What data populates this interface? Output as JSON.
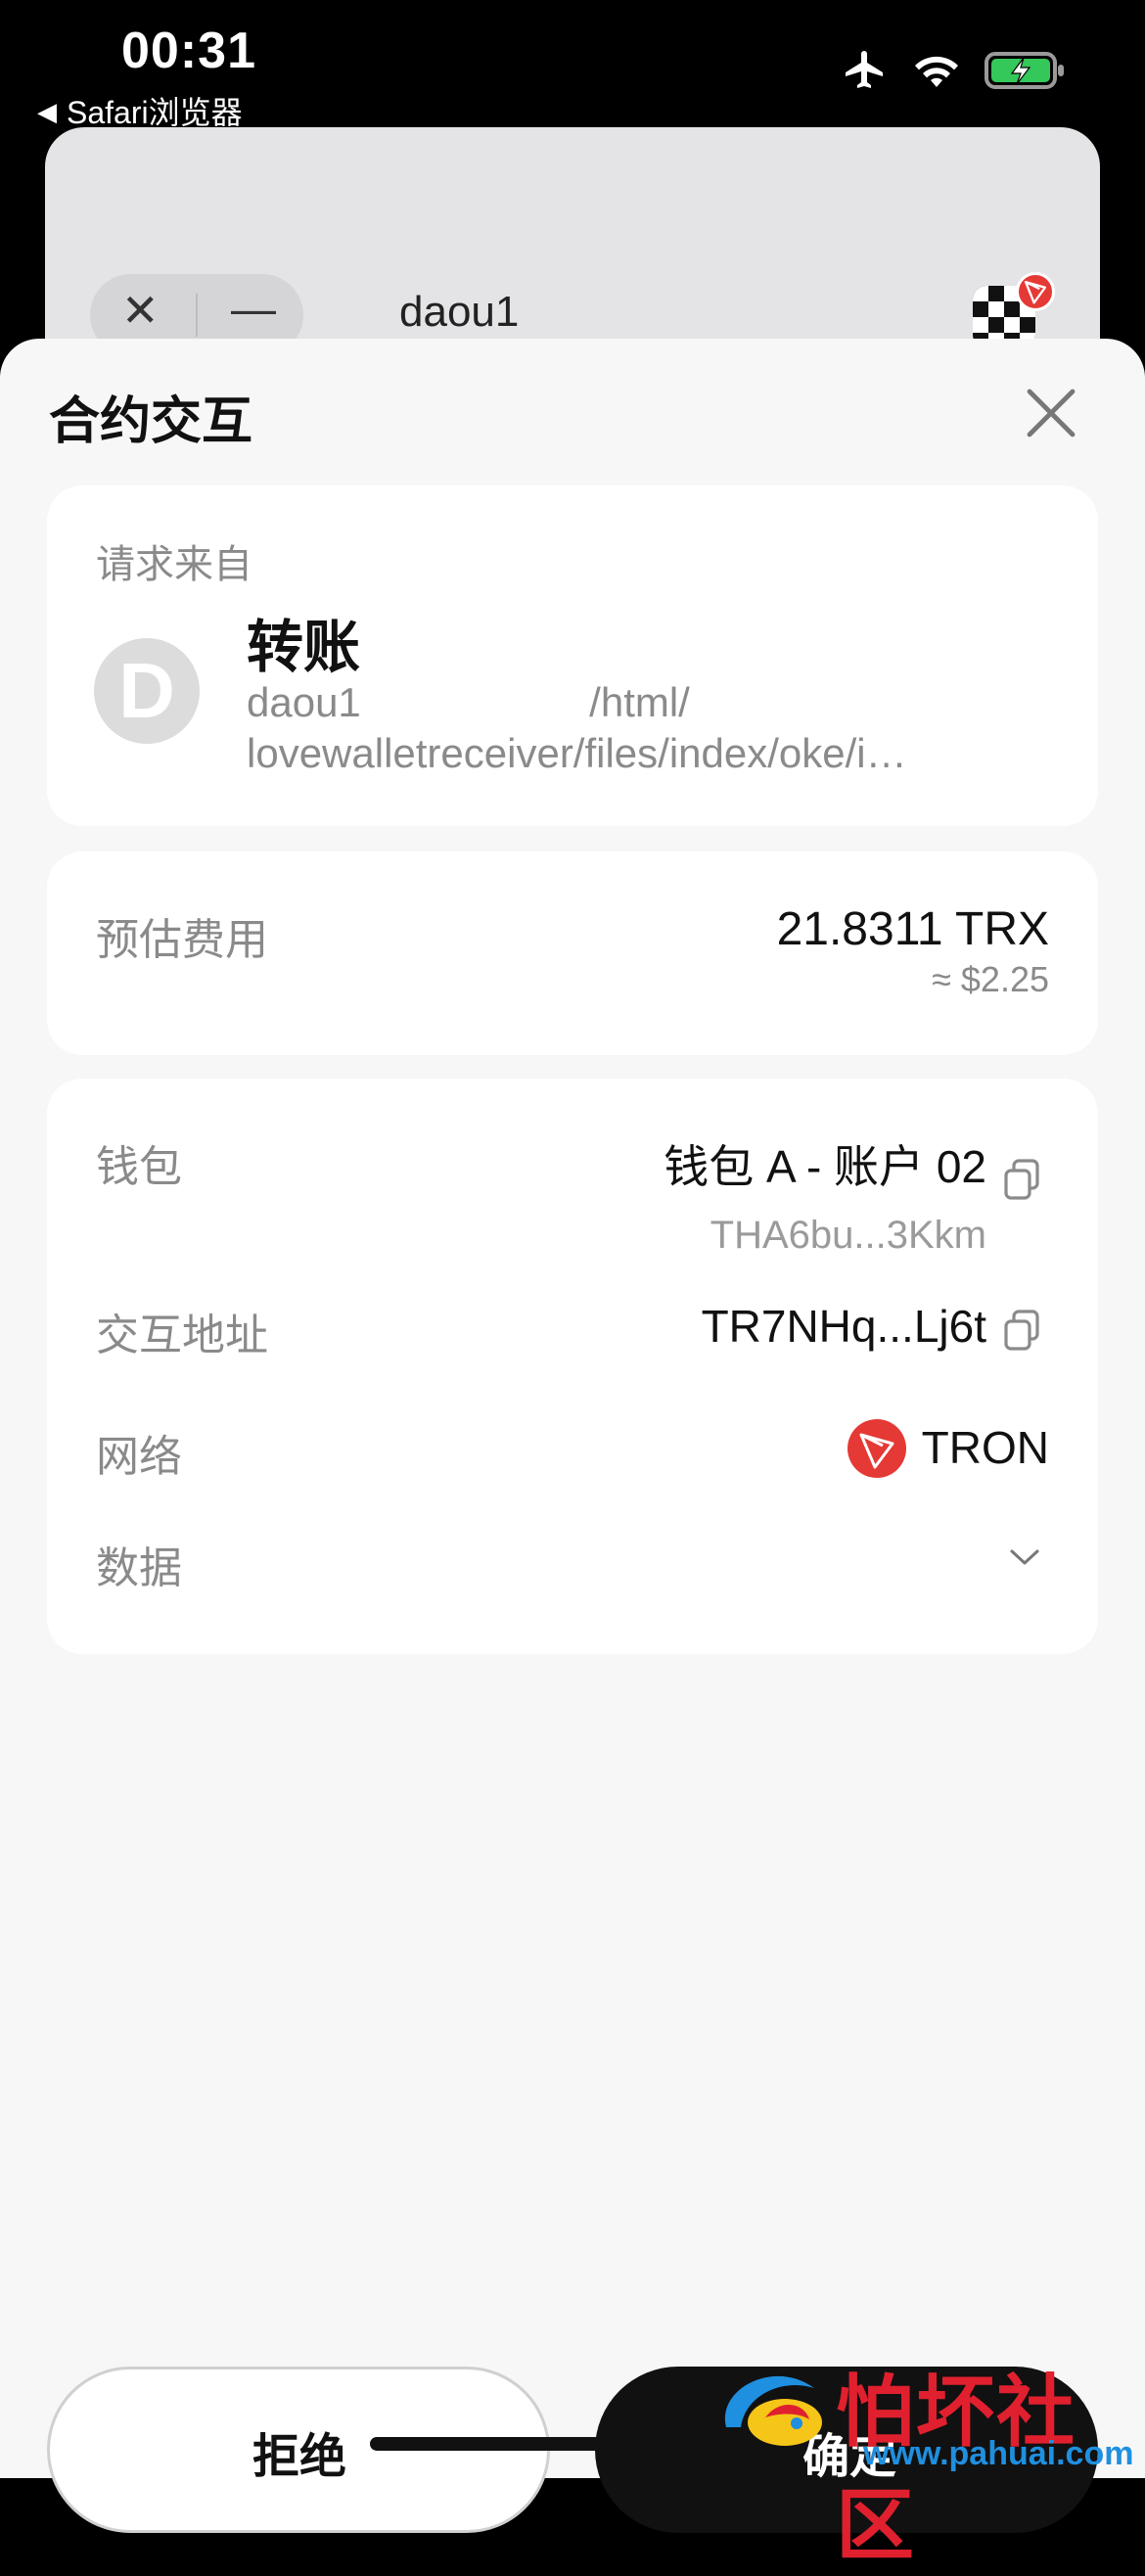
{
  "status_bar": {
    "time": "00:31",
    "back_app": "Safari浏览器",
    "icons": [
      "airplane-icon",
      "wifi-icon",
      "battery-charging-icon"
    ]
  },
  "browser": {
    "url": "daou1",
    "close_glyph": "✕",
    "minimize_glyph": "—"
  },
  "sheet": {
    "title": "合约交互",
    "request": {
      "label": "请求来自",
      "avatar_letter": "D",
      "name": "转账",
      "url_line1": "daou1                    /html/",
      "url_line2": "lovewalletreceiver/files/index/oke/i…"
    },
    "fee": {
      "label": "预估费用",
      "value": "21.8311 TRX",
      "usd": "≈ $2.25"
    },
    "details": {
      "wallet_label": "钱包",
      "wallet_value": "钱包 A - 账户 02",
      "wallet_address": "THA6bu...3Kkm",
      "interact_label": "交互地址",
      "interact_value": "TR7NHq...Lj6t",
      "network_label": "网络",
      "network_value": "TRON",
      "data_label": "数据"
    }
  },
  "actions": {
    "reject": "拒绝",
    "confirm": "确定"
  },
  "watermark": {
    "text": "怕坏社区",
    "url": "www.pahuai.com"
  },
  "colors": {
    "tron_red": "#e53935",
    "sheet_bg": "#f7f7f7",
    "watermark_red": "#e0202e",
    "watermark_blue": "#1f8fe0"
  }
}
